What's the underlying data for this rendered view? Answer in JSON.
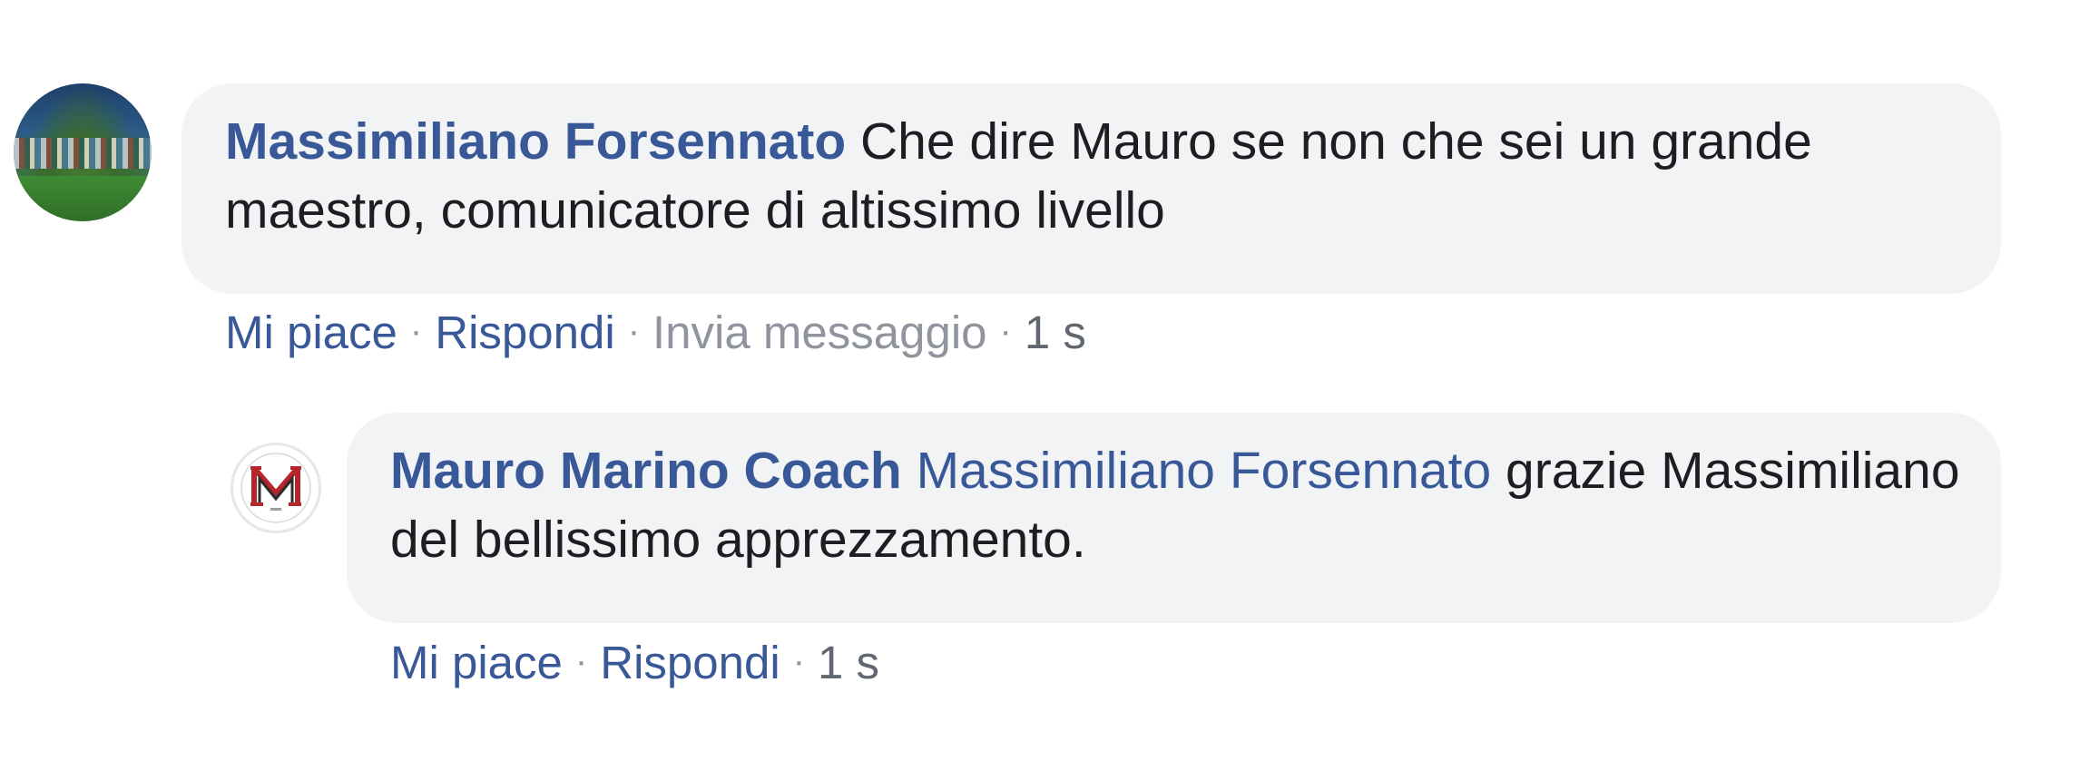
{
  "comment": {
    "avatar_icon": "profile-photo-team",
    "author": "Massimiliano Forsennato",
    "text": "Che dire Mauro se non che sei un grande maestro, comunicatore di altissimo livello",
    "actions": {
      "like": "Mi piace",
      "reply": "Rispondi",
      "message": "Invia messaggio",
      "time": "1 s"
    }
  },
  "reply": {
    "avatar_icon": "mm-monogram-logo",
    "author": "Mauro Marino Coach",
    "mention": "Massimiliano Forsennato",
    "text": "grazie Massimiliano del bellissimo apprezzamento.",
    "actions": {
      "like": "Mi piace",
      "reply": "Rispondi",
      "time": "1 s"
    }
  },
  "colors": {
    "link": "#385898",
    "bubble": "#f2f3f5",
    "muted": "#90949c",
    "text": "#1c1e21",
    "logo_red": "#b3262b"
  }
}
